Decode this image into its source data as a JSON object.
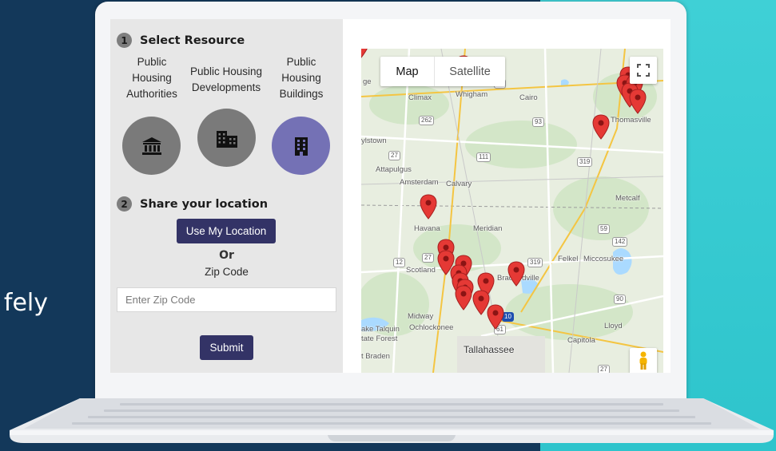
{
  "slide": {
    "text_fragment": "fely"
  },
  "panel": {
    "step1": {
      "number": "1",
      "title": "Select Resource"
    },
    "resources": [
      {
        "label": "Public Housing Authorities",
        "icon": "bank-icon",
        "selected": false
      },
      {
        "label": "Public Housing Developments",
        "icon": "city-buildings-icon",
        "selected": false
      },
      {
        "label": "Public Housing Buildings",
        "icon": "building-icon",
        "selected": true
      }
    ],
    "step2": {
      "number": "2",
      "title": "Share your location"
    },
    "use_location_label": "Use My Location",
    "or_label": "Or",
    "zip_label": "Zip Code",
    "zip_placeholder": "Enter Zip Code",
    "zip_value": "",
    "submit_label": "Submit"
  },
  "map": {
    "type_buttons": {
      "map": "Map",
      "satellite": "Satellite"
    },
    "active_type": "Map",
    "places": {
      "climax": "Climax",
      "whigham": "Whigham",
      "cairo": "Cairo",
      "thomasville": "Thomasville",
      "attapulgus": "Attapulgus",
      "amsterdam": "Amsterdam",
      "calvary": "Calvary",
      "metcalf": "Metcalf",
      "havana": "Havana",
      "meridian": "Meridian",
      "felkel": "Felkel",
      "miccosukee": "Miccosukee",
      "scotland": "Scotland",
      "bradfordville": "Bradfordville",
      "midway": "Midway",
      "ochlockonee": "Ochlockonee",
      "lake_talquin": "ake Talquin",
      "state_forest": "tate Forest",
      "lloyd": "Lloyd",
      "capitola": "Capitola",
      "tallahassee": "Tallahassee",
      "braden": "t Braden",
      "edge_ge": "ge",
      "edge_town": "ylstown"
    },
    "routes": [
      "84",
      "262",
      "93",
      "27",
      "111",
      "319",
      "59",
      "142",
      "27",
      "12",
      "319",
      "90",
      "10",
      "61",
      "27"
    ],
    "marker_color": "#e53935"
  },
  "colors": {
    "accent": "#333366",
    "selected_circle": "#7471b5",
    "circle": "#7a7a7a",
    "background_dark": "#13385a",
    "background_teal": "#3fd0d6"
  }
}
